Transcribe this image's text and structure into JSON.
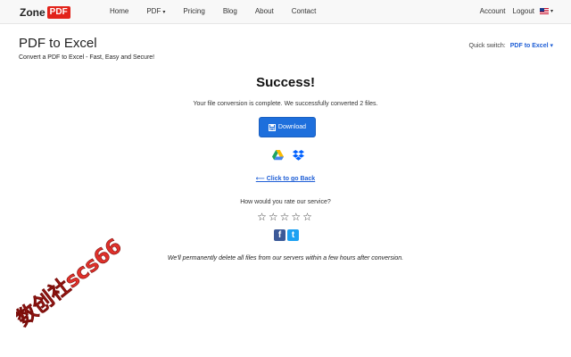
{
  "navbar": {
    "brand": "Zone",
    "brand_badge": "PDF",
    "links": [
      "Home",
      "PDF",
      "Pricing",
      "Blog",
      "About",
      "Contact"
    ],
    "pdf_caret": "▾",
    "account": "Account",
    "logout": "Logout",
    "flag_caret": "▾"
  },
  "header": {
    "title": "PDF to Excel",
    "subtitle": "Convert a PDF to Excel - Fast, Easy and Secure!",
    "quick_switch_label": "Quick switch:",
    "quick_switch_value": "PDF to Excel ▾"
  },
  "result": {
    "title": "Success!",
    "message": "Your file conversion is complete. We successfully converted 2 files.",
    "download_label": "Download",
    "back_link": "⟵ Click to go Back",
    "rate_question": "How would you rate our service?",
    "stars": "☆☆☆☆☆",
    "disclaimer": "We'll permanently delete all files from our servers within a few hours after conversion."
  },
  "social": {
    "fb": "f",
    "tw": "t"
  },
  "watermark": {
    "text": "数创社scs66",
    "color": "#e0302a"
  },
  "colors": {
    "accent": "#1e6fdc",
    "brand_red": "#e2231a",
    "facebook": "#3b5998",
    "twitter": "#1da1f2"
  }
}
